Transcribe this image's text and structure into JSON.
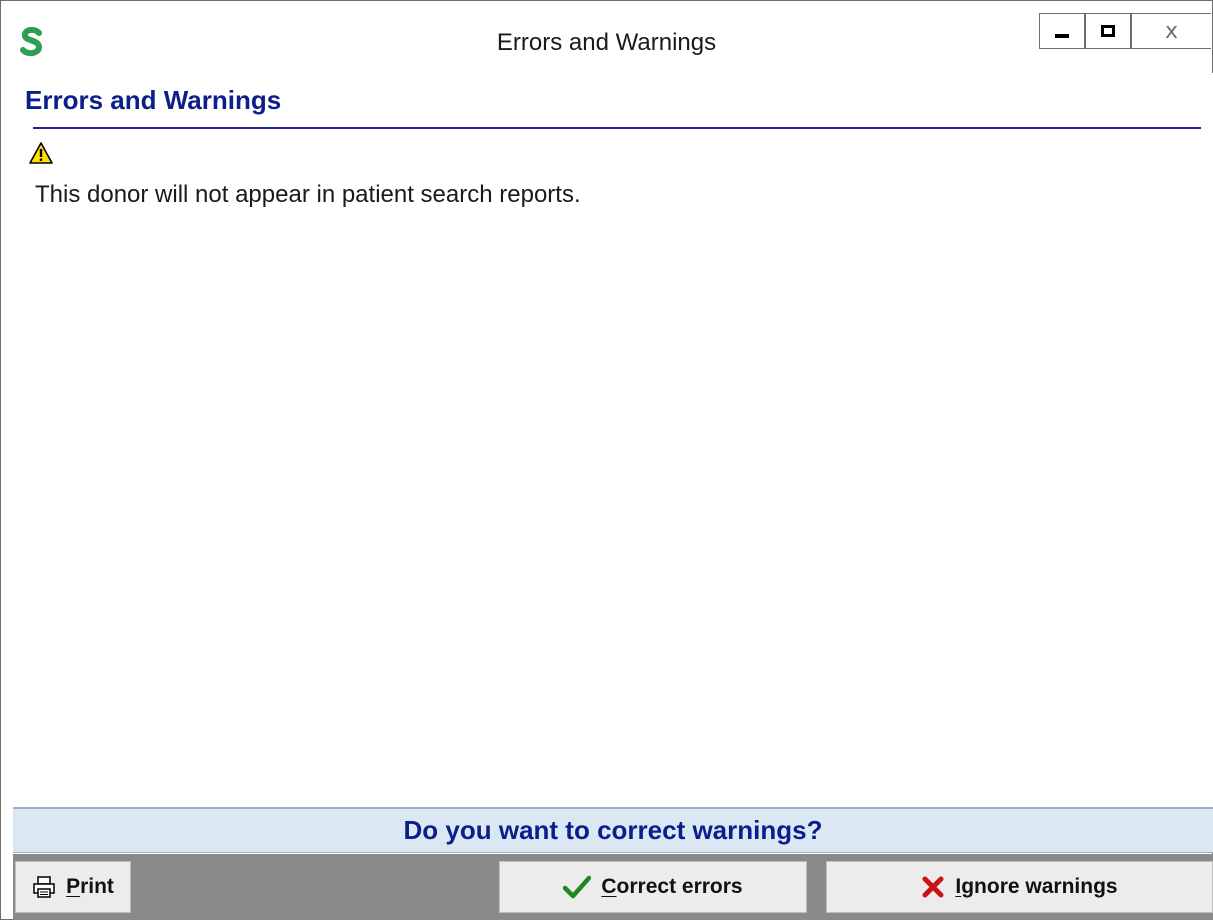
{
  "window": {
    "title": "Errors and Warnings",
    "close_label": "x"
  },
  "content": {
    "heading": "Errors and Warnings",
    "messages": [
      {
        "icon": "warning-icon",
        "text": "This donor will not appear in patient search reports."
      }
    ]
  },
  "question": {
    "text": "Do you want to correct warnings?"
  },
  "buttons": {
    "print": {
      "mnemonic": "P",
      "rest": "rint",
      "icon": "printer-icon"
    },
    "correct": {
      "mnemonic": "C",
      "rest": "orrect errors",
      "icon": "checkmark-icon"
    },
    "ignore": {
      "mnemonic": "I",
      "rest": "gnore warnings",
      "icon": "x-mark-icon"
    }
  },
  "colors": {
    "heading": "#0b1e8c",
    "question_bar_bg": "#dbe8f4",
    "button_bar_bg": "#8a8a8a",
    "check_green": "#1e8a1e",
    "x_red": "#c81414",
    "warning_yellow": "#ffe000"
  }
}
